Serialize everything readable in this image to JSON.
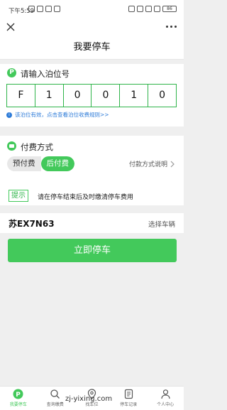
{
  "status_bar": {
    "time": "下午5:59",
    "battery": "86"
  },
  "title": "我要停车",
  "berth": {
    "title": "请输入泊位号",
    "chars": [
      "F",
      "1",
      "0",
      "0",
      "1",
      "0"
    ],
    "info": "该泊位有效，点击查看泊位收费规则>>"
  },
  "payment": {
    "title": "付费方式",
    "options": [
      "预付费",
      "后付费"
    ],
    "selected": "后付费",
    "explain": "付款方式说明",
    "hint_tag": "提示",
    "hint_text": "请在停车结束后及时缴清停车费用"
  },
  "vehicle": {
    "plate": "苏EX7N63",
    "select": "选择车辆"
  },
  "action": {
    "park_now": "立即停车"
  },
  "nav": {
    "items": [
      "我要停车",
      "查询缴费",
      "找车位",
      "停车记录",
      "个人中心"
    ],
    "active_index": 0
  },
  "watermark": "zj-yixing.com",
  "colors": {
    "accent": "#43c95b",
    "link": "#2d7bd8"
  }
}
